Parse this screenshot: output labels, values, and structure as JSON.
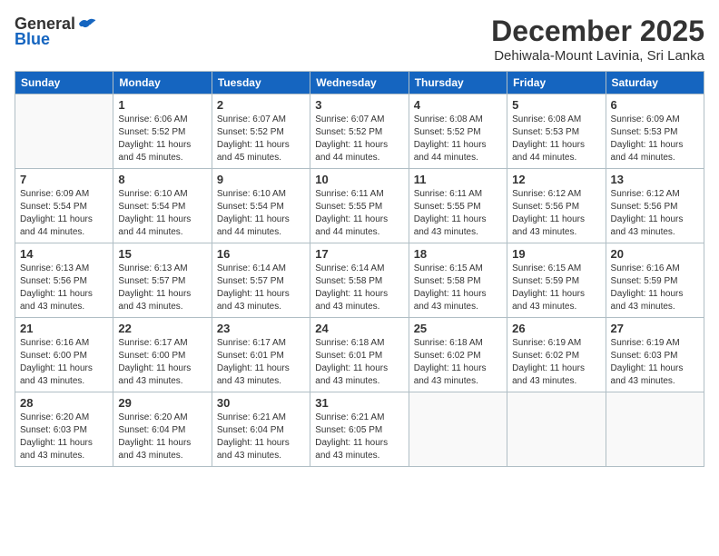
{
  "header": {
    "logo_general": "General",
    "logo_blue": "Blue",
    "month": "December 2025",
    "location": "Dehiwala-Mount Lavinia, Sri Lanka"
  },
  "days_of_week": [
    "Sunday",
    "Monday",
    "Tuesday",
    "Wednesday",
    "Thursday",
    "Friday",
    "Saturday"
  ],
  "weeks": [
    [
      {
        "day": "",
        "info": ""
      },
      {
        "day": "1",
        "info": "Sunrise: 6:06 AM\nSunset: 5:52 PM\nDaylight: 11 hours\nand 45 minutes."
      },
      {
        "day": "2",
        "info": "Sunrise: 6:07 AM\nSunset: 5:52 PM\nDaylight: 11 hours\nand 45 minutes."
      },
      {
        "day": "3",
        "info": "Sunrise: 6:07 AM\nSunset: 5:52 PM\nDaylight: 11 hours\nand 44 minutes."
      },
      {
        "day": "4",
        "info": "Sunrise: 6:08 AM\nSunset: 5:52 PM\nDaylight: 11 hours\nand 44 minutes."
      },
      {
        "day": "5",
        "info": "Sunrise: 6:08 AM\nSunset: 5:53 PM\nDaylight: 11 hours\nand 44 minutes."
      },
      {
        "day": "6",
        "info": "Sunrise: 6:09 AM\nSunset: 5:53 PM\nDaylight: 11 hours\nand 44 minutes."
      }
    ],
    [
      {
        "day": "7",
        "info": "Sunrise: 6:09 AM\nSunset: 5:54 PM\nDaylight: 11 hours\nand 44 minutes."
      },
      {
        "day": "8",
        "info": "Sunrise: 6:10 AM\nSunset: 5:54 PM\nDaylight: 11 hours\nand 44 minutes."
      },
      {
        "day": "9",
        "info": "Sunrise: 6:10 AM\nSunset: 5:54 PM\nDaylight: 11 hours\nand 44 minutes."
      },
      {
        "day": "10",
        "info": "Sunrise: 6:11 AM\nSunset: 5:55 PM\nDaylight: 11 hours\nand 44 minutes."
      },
      {
        "day": "11",
        "info": "Sunrise: 6:11 AM\nSunset: 5:55 PM\nDaylight: 11 hours\nand 43 minutes."
      },
      {
        "day": "12",
        "info": "Sunrise: 6:12 AM\nSunset: 5:56 PM\nDaylight: 11 hours\nand 43 minutes."
      },
      {
        "day": "13",
        "info": "Sunrise: 6:12 AM\nSunset: 5:56 PM\nDaylight: 11 hours\nand 43 minutes."
      }
    ],
    [
      {
        "day": "14",
        "info": "Sunrise: 6:13 AM\nSunset: 5:56 PM\nDaylight: 11 hours\nand 43 minutes."
      },
      {
        "day": "15",
        "info": "Sunrise: 6:13 AM\nSunset: 5:57 PM\nDaylight: 11 hours\nand 43 minutes."
      },
      {
        "day": "16",
        "info": "Sunrise: 6:14 AM\nSunset: 5:57 PM\nDaylight: 11 hours\nand 43 minutes."
      },
      {
        "day": "17",
        "info": "Sunrise: 6:14 AM\nSunset: 5:58 PM\nDaylight: 11 hours\nand 43 minutes."
      },
      {
        "day": "18",
        "info": "Sunrise: 6:15 AM\nSunset: 5:58 PM\nDaylight: 11 hours\nand 43 minutes."
      },
      {
        "day": "19",
        "info": "Sunrise: 6:15 AM\nSunset: 5:59 PM\nDaylight: 11 hours\nand 43 minutes."
      },
      {
        "day": "20",
        "info": "Sunrise: 6:16 AM\nSunset: 5:59 PM\nDaylight: 11 hours\nand 43 minutes."
      }
    ],
    [
      {
        "day": "21",
        "info": "Sunrise: 6:16 AM\nSunset: 6:00 PM\nDaylight: 11 hours\nand 43 minutes."
      },
      {
        "day": "22",
        "info": "Sunrise: 6:17 AM\nSunset: 6:00 PM\nDaylight: 11 hours\nand 43 minutes."
      },
      {
        "day": "23",
        "info": "Sunrise: 6:17 AM\nSunset: 6:01 PM\nDaylight: 11 hours\nand 43 minutes."
      },
      {
        "day": "24",
        "info": "Sunrise: 6:18 AM\nSunset: 6:01 PM\nDaylight: 11 hours\nand 43 minutes."
      },
      {
        "day": "25",
        "info": "Sunrise: 6:18 AM\nSunset: 6:02 PM\nDaylight: 11 hours\nand 43 minutes."
      },
      {
        "day": "26",
        "info": "Sunrise: 6:19 AM\nSunset: 6:02 PM\nDaylight: 11 hours\nand 43 minutes."
      },
      {
        "day": "27",
        "info": "Sunrise: 6:19 AM\nSunset: 6:03 PM\nDaylight: 11 hours\nand 43 minutes."
      }
    ],
    [
      {
        "day": "28",
        "info": "Sunrise: 6:20 AM\nSunset: 6:03 PM\nDaylight: 11 hours\nand 43 minutes."
      },
      {
        "day": "29",
        "info": "Sunrise: 6:20 AM\nSunset: 6:04 PM\nDaylight: 11 hours\nand 43 minutes."
      },
      {
        "day": "30",
        "info": "Sunrise: 6:21 AM\nSunset: 6:04 PM\nDaylight: 11 hours\nand 43 minutes."
      },
      {
        "day": "31",
        "info": "Sunrise: 6:21 AM\nSunset: 6:05 PM\nDaylight: 11 hours\nand 43 minutes."
      },
      {
        "day": "",
        "info": ""
      },
      {
        "day": "",
        "info": ""
      },
      {
        "day": "",
        "info": ""
      }
    ]
  ]
}
